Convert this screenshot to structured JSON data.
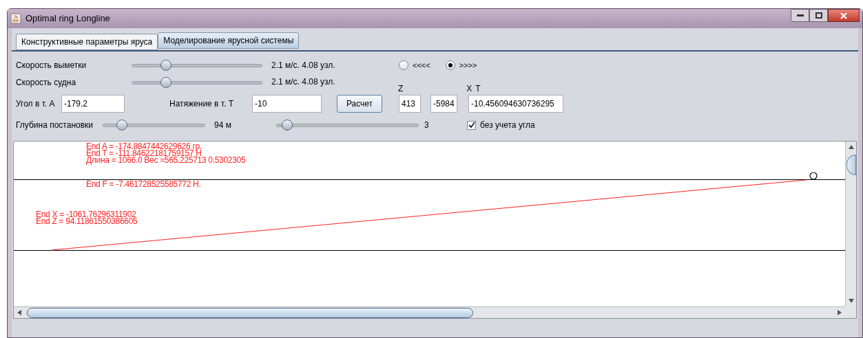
{
  "window": {
    "title": "Optimal ring Longline"
  },
  "tabs": [
    {
      "label": "Конструктивные параметры яруса",
      "selected": false
    },
    {
      "label": "Моделирование ярусной системы",
      "selected": true
    }
  ],
  "speed_sliders": [
    {
      "label": "Скорость выметки",
      "level": 0.24,
      "reading": "2.1  м/с. 4.08 узл."
    },
    {
      "label": "Скорость судна",
      "level": 0.24,
      "reading": "2.1  м/с. 4.08 узл."
    }
  ],
  "direction": [
    {
      "label": "<<<<",
      "selected": false
    },
    {
      "label": ">>>>",
      "selected": true
    }
  ],
  "column_labels": [
    "Z",
    "X",
    "T"
  ],
  "angle": {
    "label": "Угол в т. А",
    "value": "-179.2"
  },
  "tension": {
    "label": "Натяжение в т. Т",
    "value": "-10"
  },
  "calc_button": "Расчет",
  "outputs": [
    "413",
    "-5984",
    "-10.456094630736295"
  ],
  "depth": {
    "label": "Глубина постановки",
    "level": 0.15,
    "reading": "94 м"
  },
  "count_slider": {
    "level": 0.04,
    "reading": "3"
  },
  "ignore_angle": {
    "label": "без учета угла",
    "checked": true
  },
  "canvas": {
    "top_texts": [
      "End A = -174.8847442629626 гр.",
      "End T = -111.84622181759157 Н",
      "Длина = 1066.0 Вес =565.225713 0.5302305"
    ],
    "force_text": "End F = -7.461728525585772 Н.",
    "end_texts": [
      "End X = -1061.76296311902",
      "End Z = 94.11861550386605"
    ]
  }
}
